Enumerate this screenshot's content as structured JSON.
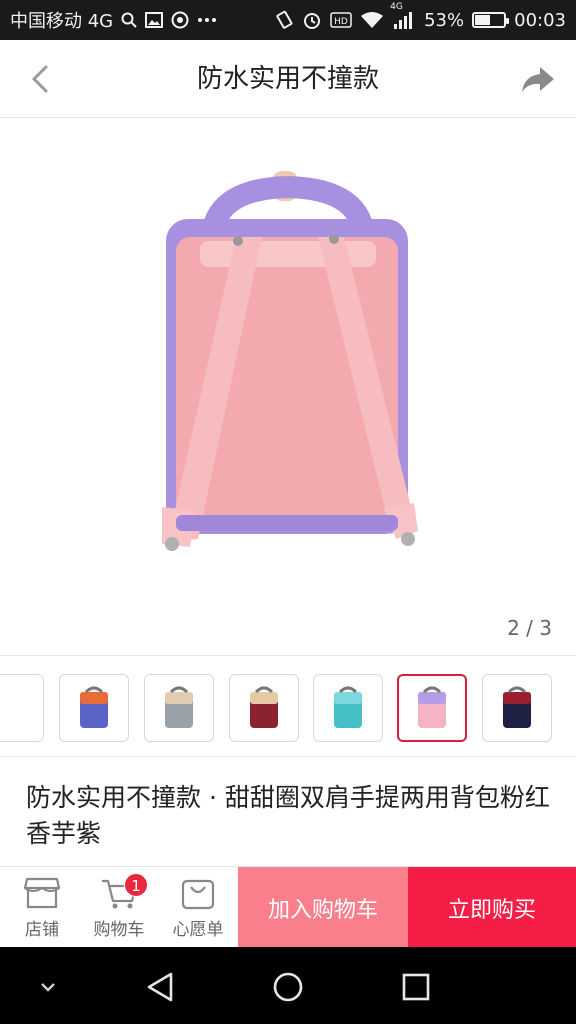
{
  "status_bar": {
    "carrier": "中国移动 4G",
    "network_badge": "4G",
    "battery_pct": "53%",
    "battery_level": 0.53,
    "time": "00:03",
    "icons": [
      "search-icon",
      "image-icon",
      "camera-icon",
      "more-icon",
      "vibrate-icon",
      "alarm-icon",
      "hd-icon",
      "wifi-icon",
      "signal-icon",
      "battery-icon"
    ]
  },
  "header": {
    "title": "防水实用不撞款",
    "back_icon": "chevron-left-icon",
    "share_icon": "share-arrow-icon"
  },
  "gallery": {
    "counter": "2 / 3",
    "colors": {
      "pink": "#f5b3b8",
      "lavender": "#a890e0"
    }
  },
  "thumbnails": [
    {
      "name": "partial-thumbnail",
      "body": "#e8e8e8",
      "accent": "#dddddd"
    },
    {
      "name": "orange-blue-backpack",
      "body": "#5b63c7",
      "accent": "#e86c3a"
    },
    {
      "name": "grey-backpack",
      "body": "#9aa0a8",
      "accent": "#e3cdb0"
    },
    {
      "name": "maroon-backpack",
      "body": "#8b2230",
      "accent": "#e6c9a7"
    },
    {
      "name": "teal-backpack",
      "body": "#45c0c7",
      "accent": "#7dd8de"
    },
    {
      "name": "pink-lavender-backpack",
      "body": "#f5b3c4",
      "accent": "#b79be6",
      "selected": true
    },
    {
      "name": "navy-red-backpack",
      "body": "#1f2144",
      "accent": "#9b1f2e"
    }
  ],
  "product": {
    "title": "防水实用不撞款 · 甜甜圈双肩手提两用背包粉红香芋紫"
  },
  "action_bar": {
    "shop_label": "店铺",
    "cart_label": "购物车",
    "cart_badge": "1",
    "wishlist_label": "心愿单",
    "add_to_cart": "加入购物车",
    "buy_now": "立即购买",
    "colors": {
      "add_to_cart_bg": "#f97f8c",
      "buy_now_bg": "#f41e46",
      "badge_bg": "#e8283c"
    }
  },
  "nav_bar": {
    "icons": [
      "chevron-down-icon",
      "back-triangle-icon",
      "home-circle-icon",
      "recent-square-icon"
    ]
  }
}
